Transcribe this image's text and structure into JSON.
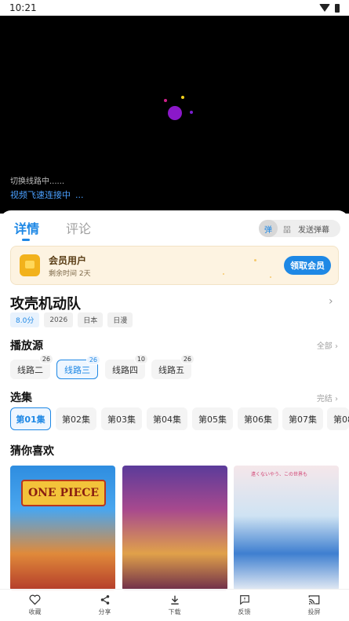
{
  "status_bar": {
    "time": "10:21"
  },
  "player": {
    "switch_text": "切换线路中......",
    "connecting_text": "视频飞速连接中",
    "connecting_dots": "..."
  },
  "tabs": {
    "detail": "详情",
    "comment": "评论"
  },
  "danmaku": {
    "toggle": "弹",
    "settings": "㗊",
    "send": "发送弹幕"
  },
  "vip": {
    "title": "会员用户",
    "remaining": "剩余时间 2天",
    "button": "领取会员",
    "accent": "#1e88e5"
  },
  "video": {
    "title": "攻壳机动队",
    "tags": [
      "8.0分",
      "2026",
      "日本",
      "日漫"
    ]
  },
  "sources": {
    "title": "播放源",
    "more": "全部",
    "items": [
      {
        "label": "线路二",
        "count": "26"
      },
      {
        "label": "线路三",
        "count": "26"
      },
      {
        "label": "线路四",
        "count": "10"
      },
      {
        "label": "线路五",
        "count": "26"
      }
    ],
    "selected": "线路三"
  },
  "episodes": {
    "title": "选集",
    "status": "完结",
    "items": [
      "第01集",
      "第02集",
      "第03集",
      "第04集",
      "第05集",
      "第06集",
      "第07集",
      "第08"
    ],
    "selected": "第01集"
  },
  "recommend": {
    "title": "猜你喜欢",
    "posters": [
      {
        "logo": "ONE PIECE"
      },
      {
        "logo": ""
      },
      {
        "top_text": "遠くないやう、この世界も"
      }
    ]
  },
  "bottom_bar": [
    {
      "label": "收藏",
      "icon": "heart-icon"
    },
    {
      "label": "分享",
      "icon": "share-icon"
    },
    {
      "label": "下载",
      "icon": "download-icon"
    },
    {
      "label": "反馈",
      "icon": "feedback-icon"
    },
    {
      "label": "投屏",
      "icon": "cast-icon"
    }
  ]
}
